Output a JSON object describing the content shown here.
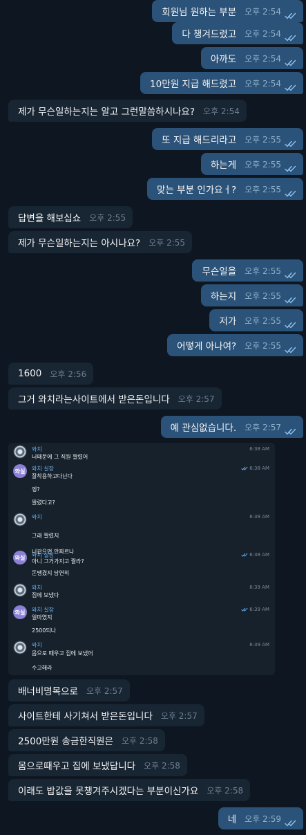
{
  "colors": {
    "background": "#0e1621",
    "outgoing_bubble": "#2b5278",
    "incoming_bubble": "#182533",
    "read_check": "#8ec3f2"
  },
  "messages": [
    {
      "dir": "out",
      "text": "회원님 원하는 부분",
      "time": "오후 2:54"
    },
    {
      "dir": "out",
      "text": "다 챙겨드렸고",
      "time": "오후 2:54"
    },
    {
      "dir": "out",
      "text": "아까도",
      "time": "오후 2:54"
    },
    {
      "dir": "out",
      "text": "10만원 지급 해드렸고",
      "time": "오후 2:54"
    },
    {
      "dir": "in",
      "text": "제가 무슨일하는지는 알고 그런말씀하시나요?",
      "time": "오후 2:54"
    },
    {
      "dir": "out",
      "text": "또 지급 해드리라고",
      "time": "오후 2:55"
    },
    {
      "dir": "out",
      "text": "하는게",
      "time": "오후 2:55"
    },
    {
      "dir": "out",
      "text": "맞는 부분 인가요ㅓ?",
      "time": "오후 2:55"
    },
    {
      "dir": "in",
      "text": "답변을 해보십쇼",
      "time": "오후 2:55"
    },
    {
      "dir": "in",
      "text": "제가 무슨일하는지는 아시나요?",
      "time": "오후 2:55"
    },
    {
      "dir": "out",
      "text": "무슨일을",
      "time": "오후 2:55"
    },
    {
      "dir": "out",
      "text": "하는지",
      "time": "오후 2:55"
    },
    {
      "dir": "out",
      "text": "저가",
      "time": "오후 2:55"
    },
    {
      "dir": "out",
      "text": "어떻게 아나여?",
      "time": "오후 2:55"
    },
    {
      "dir": "in",
      "text": "1600",
      "time": "오후 2:56"
    },
    {
      "dir": "in",
      "text": "그거 와치라는사이트에서 받은돈입니다",
      "time": "오후 2:57"
    },
    {
      "dir": "out",
      "text": "예 관심없습니다.",
      "time": "오후 2:57"
    },
    {
      "dir": "in",
      "text": "배너비명목으로",
      "time": "오후 2:57"
    },
    {
      "dir": "in",
      "text": "사이트한테 사기쳐서 받은돈입니다",
      "time": "오후 2:57"
    },
    {
      "dir": "in",
      "text": "2500만원 송금한직원은",
      "time": "오후 2:58"
    },
    {
      "dir": "in",
      "text": "몸으로때우고 집에 보냈답니다",
      "time": "오후 2:58"
    },
    {
      "dir": "in",
      "text": "이래도 밥값을 못챙겨주시겠다는 부분이신가요",
      "time": "오후 2:58"
    },
    {
      "dir": "out",
      "text": "네",
      "time": "오후 2:59"
    }
  ],
  "screenshot": {
    "items": [
      {
        "kind": "head",
        "avatar": "watch",
        "name": "와치",
        "time": "6:38 AM",
        "read": false
      },
      {
        "kind": "text",
        "text": "너때문에 그 직원 짤렸어"
      },
      {
        "kind": "head",
        "avatar": "badge",
        "badge": "와실",
        "name": "와치 실장",
        "time": "6:38 AM",
        "read": true
      },
      {
        "kind": "text",
        "text": "잘착용하고다닌다"
      },
      {
        "kind": "text",
        "text": "엥?"
      },
      {
        "kind": "text",
        "text": "짤렸다고?"
      },
      {
        "kind": "head",
        "avatar": "watch",
        "name": "와치",
        "time": "6:38 AM",
        "read": false
      },
      {
        "kind": "text",
        "text": "그래 짤렸지"
      },
      {
        "kind": "text",
        "text": "너같으면 안짜르나"
      },
      {
        "kind": "head",
        "avatar": "badge",
        "badge": "와실",
        "name": "와치 실장",
        "time": "6:38 AM",
        "read": true
      },
      {
        "kind": "text",
        "text": "아니 그거가지고 짤라?"
      },
      {
        "kind": "text",
        "text": "돈땡겼지 당연히"
      },
      {
        "kind": "head",
        "avatar": "watch",
        "name": "와치",
        "time": "6:39 AM",
        "read": false
      },
      {
        "kind": "text",
        "text": "집에 보냈다"
      },
      {
        "kind": "head",
        "avatar": "badge",
        "badge": "와실",
        "name": "와치 실장",
        "time": "6:39 AM",
        "read": true
      },
      {
        "kind": "text",
        "text": "얼마였지"
      },
      {
        "kind": "text",
        "text": "2500되나"
      },
      {
        "kind": "head",
        "avatar": "watch",
        "name": "와치",
        "time": "6:39 AM",
        "read": false
      },
      {
        "kind": "text",
        "text": "몸으로 때우고 집에 보냈어"
      },
      {
        "kind": "text",
        "text": "수고해라"
      }
    ]
  }
}
